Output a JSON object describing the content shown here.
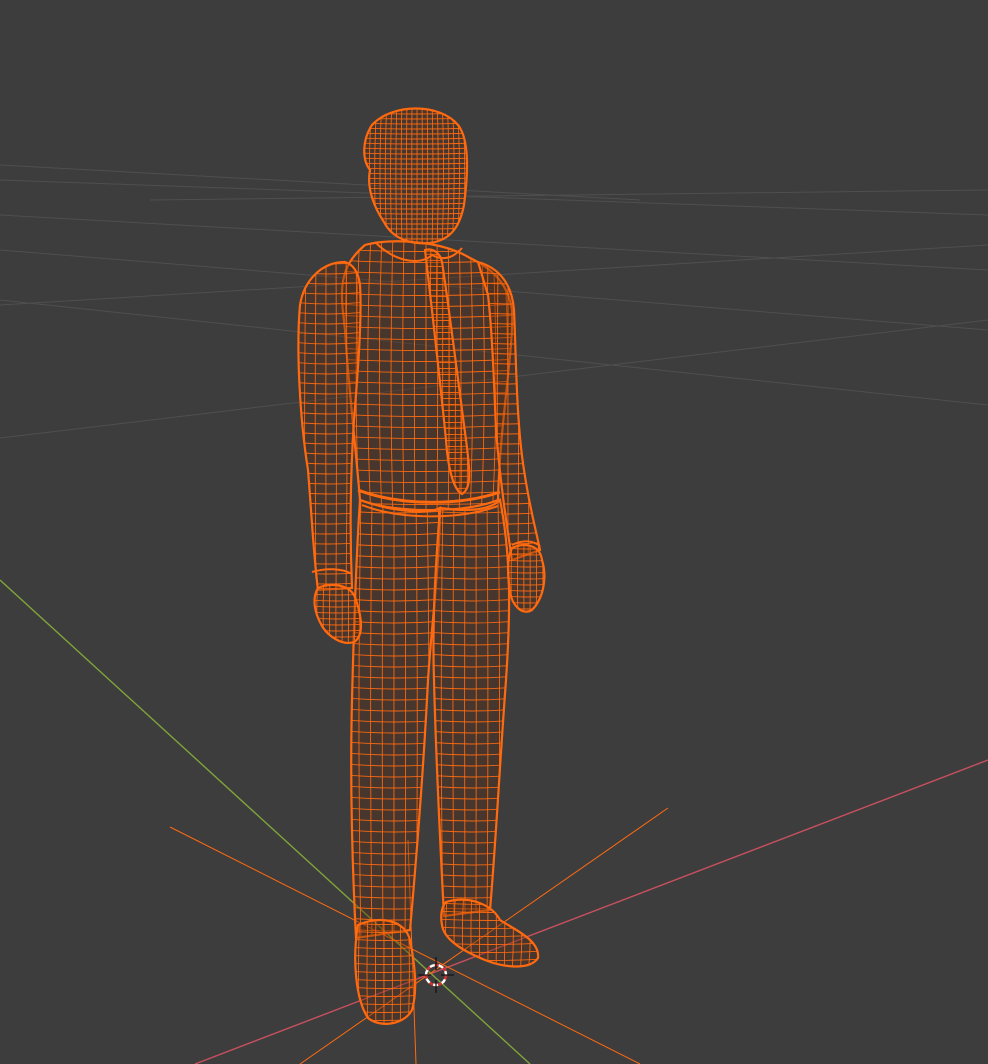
{
  "viewport": {
    "background": "#3d3d3d",
    "grid_color": "#4f4f4f",
    "axis_x_color": "#c8505f",
    "axis_y_color": "#7ea43a",
    "wire_color": "#ff6a10",
    "selection_outline_color": "#ff7f20",
    "cursor_colors": [
      "#d63232",
      "#ffffff"
    ],
    "shading_mode": "wireframe",
    "selected_object": "human-figure"
  }
}
